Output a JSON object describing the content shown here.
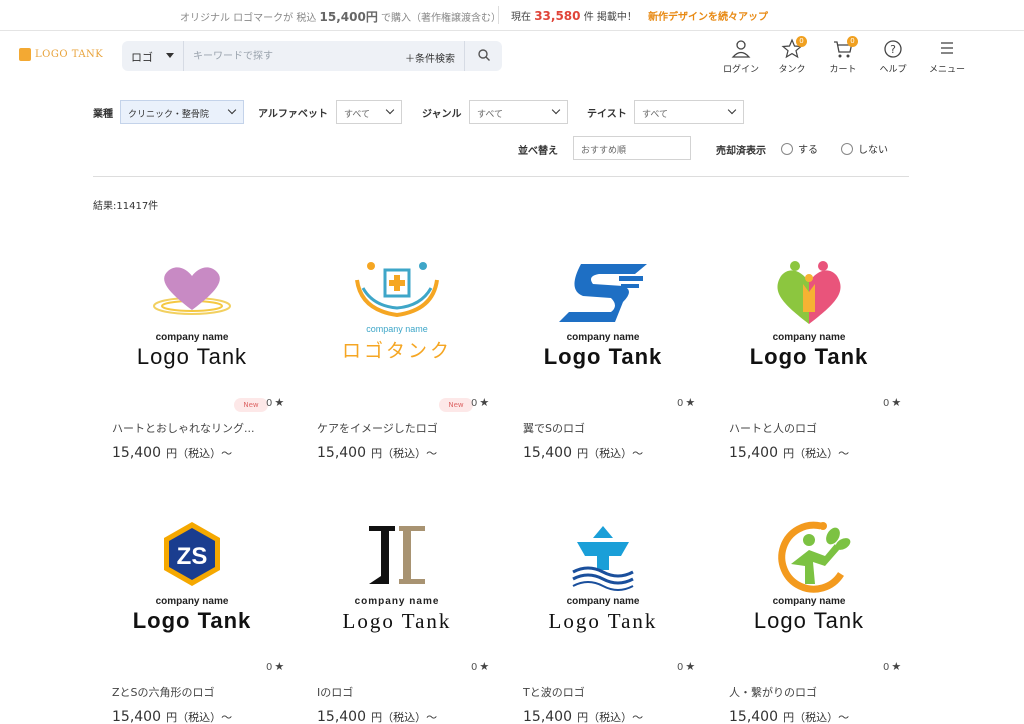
{
  "banner": {
    "prefix": "オリジナル ロゴマークが 税込",
    "price": "15,400円",
    "suffix": "で購入（著作権譲渡含む）",
    "now": "現在",
    "count": "33,580",
    "count_suffix": "件 掲載中！",
    "new_designs": "新作デザインを続々アップ"
  },
  "header": {
    "logo_text": "LOGO TANK",
    "search": {
      "category": "ロゴ",
      "placeholder": "キーワードで探す",
      "conditions": "＋条件検索"
    },
    "nav": [
      {
        "label": "ログイン",
        "icon": "user-icon"
      },
      {
        "label": "タンク",
        "icon": "star-icon",
        "badge": "0"
      },
      {
        "label": "カート",
        "icon": "cart-icon",
        "badge": "0"
      },
      {
        "label": "ヘルプ",
        "icon": "help-icon"
      },
      {
        "label": "メニュー",
        "icon": "menu-icon"
      }
    ]
  },
  "filters": {
    "industry": {
      "label": "業種",
      "value": "クリニック・整骨院"
    },
    "alphabet": {
      "label": "アルファベット",
      "value": "すべて"
    },
    "genre": {
      "label": "ジャンル",
      "value": "すべて"
    },
    "taste": {
      "label": "テイスト",
      "value": "すべて"
    },
    "sort": {
      "label": "並べ替え",
      "value": "おすすめ順"
    },
    "sold": {
      "label": "売却済表示",
      "options": [
        "する",
        "しない"
      ]
    }
  },
  "result_text": "結果:11417件",
  "colors": {
    "accent_orange": "#f0a020",
    "count_red": "#e0453a"
  },
  "products": [
    {
      "title": "ハートとおしゃれなリング...",
      "new": "New",
      "fav": "0",
      "price": "15,400",
      "price_unit": "円（税込）〜",
      "sub": "company name",
      "main": "Logo Tank"
    },
    {
      "title": "ケアをイメージしたロゴ",
      "new": "New",
      "fav": "0",
      "price": "15,400",
      "price_unit": "円（税込）〜",
      "sub": "company name",
      "main": "ロゴタンク"
    },
    {
      "title": "翼でSのロゴ",
      "new": "",
      "fav": "0",
      "price": "15,400",
      "price_unit": "円（税込）〜",
      "sub": "company name",
      "main": "Logo Tank"
    },
    {
      "title": "ハートと人のロゴ",
      "new": "",
      "fav": "0",
      "price": "15,400",
      "price_unit": "円（税込）〜",
      "sub": "company name",
      "main": "Logo Tank"
    },
    {
      "title": "ZとSの六角形のロゴ",
      "new": "",
      "fav": "0",
      "price": "15,400",
      "price_unit": "円（税込）〜",
      "sub": "company name",
      "main": "Logo Tank"
    },
    {
      "title": "Iのロゴ",
      "new": "",
      "fav": "0",
      "price": "15,400",
      "price_unit": "円（税込）〜",
      "sub": "company name",
      "main": "Logo Tank"
    },
    {
      "title": "Tと波のロゴ",
      "new": "",
      "fav": "0",
      "price": "15,400",
      "price_unit": "円（税込）〜",
      "sub": "company name",
      "main": "Logo Tank"
    },
    {
      "title": "人・繋がりのロゴ",
      "new": "",
      "fav": "0",
      "price": "15,400",
      "price_unit": "円（税込）〜",
      "sub": "company name",
      "main": "Logo Tank"
    }
  ]
}
